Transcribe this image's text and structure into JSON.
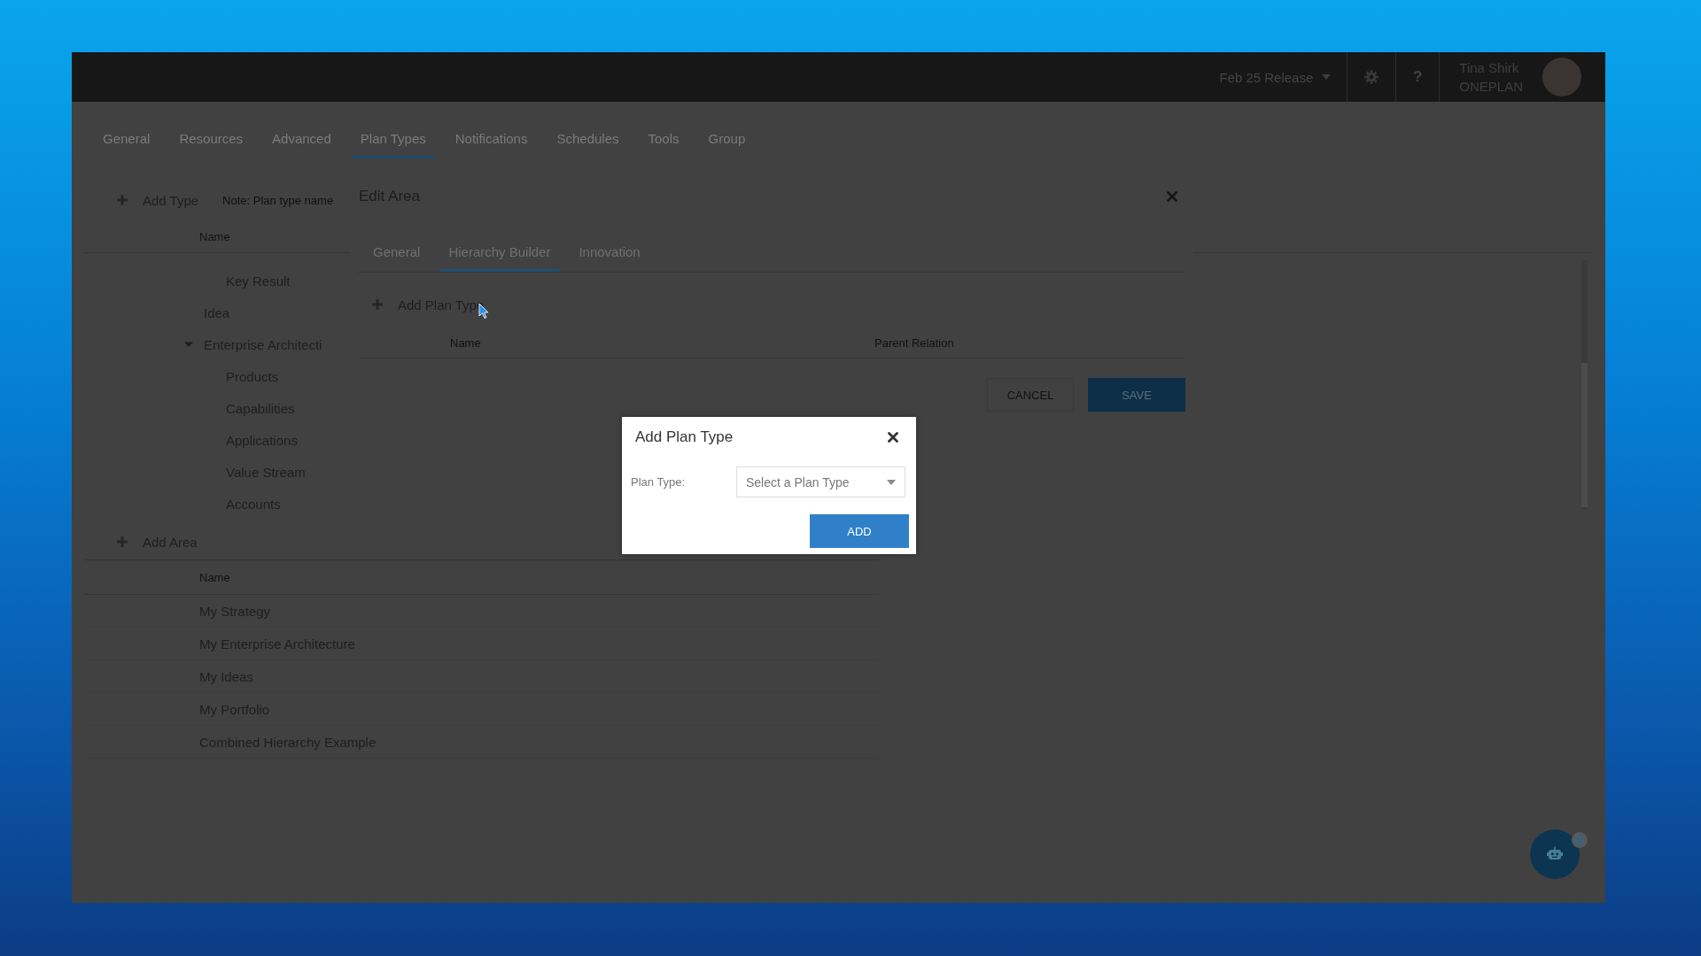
{
  "topbar": {
    "release": "Feb 25 Release",
    "help": "?",
    "user": {
      "name": "Tina Shirk",
      "org": "ONEPLAN"
    }
  },
  "tabs": [
    {
      "label": "General",
      "selected": false
    },
    {
      "label": "Resources",
      "selected": false
    },
    {
      "label": "Advanced",
      "selected": false
    },
    {
      "label": "Plan Types",
      "selected": true
    },
    {
      "label": "Notifications",
      "selected": false
    },
    {
      "label": "Schedules",
      "selected": false
    },
    {
      "label": "Tools",
      "selected": false
    },
    {
      "label": "Group",
      "selected": false
    }
  ],
  "plan_types": {
    "add_button": "Add Type",
    "note": "Note: Plan type name",
    "column": "Name",
    "tree": [
      {
        "children": [
          {
            "label": "Key Result"
          }
        ]
      },
      {
        "label": "Idea"
      },
      {
        "label": "Enterprise Architecti",
        "expanded": true,
        "children": [
          {
            "label": "Products"
          },
          {
            "label": "Capabilities"
          },
          {
            "label": "Applications"
          },
          {
            "label": "Value Stream"
          },
          {
            "label": "Accounts"
          }
        ]
      }
    ]
  },
  "edit_area": {
    "title": "Edit Area",
    "tabs": [
      {
        "label": "General",
        "selected": false
      },
      {
        "label": "Hierarchy Builder",
        "selected": true
      },
      {
        "label": "Innovation",
        "selected": false
      }
    ],
    "add_button": "Add Plan Type",
    "columns": [
      "Name",
      "Parent Relation"
    ],
    "buttons": [
      {
        "label": "CANCEL",
        "kind": "secondary"
      },
      {
        "label": "SAVE",
        "kind": "primary"
      }
    ]
  },
  "areas": {
    "add_button": "Add Area",
    "column": "Name",
    "rows": [
      "My Strategy",
      "My Enterprise Architecture",
      "My Ideas",
      "My Portfolio",
      "Combined Hierarchy Example"
    ]
  },
  "dialog": {
    "title": "Add Plan Type",
    "field": {
      "label": "Plan Type:",
      "placeholder": "Select a Plan Type"
    },
    "button": "ADD"
  }
}
